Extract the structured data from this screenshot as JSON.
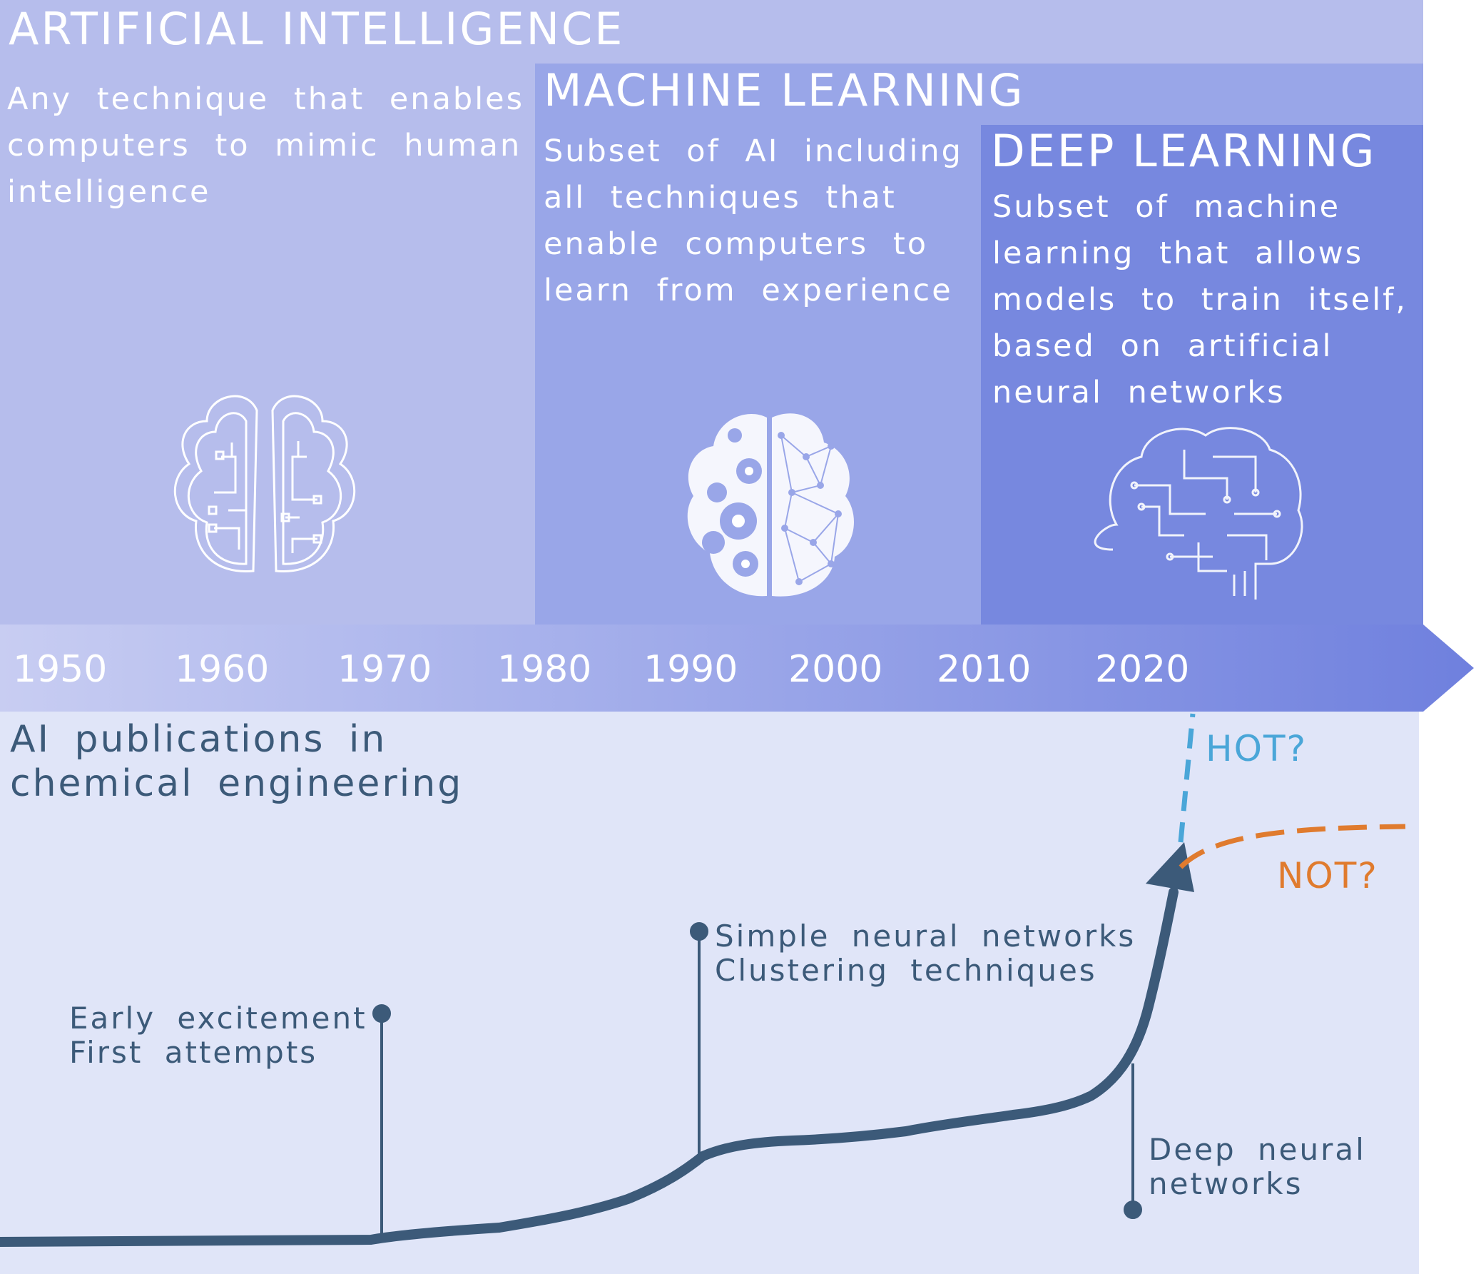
{
  "colors": {
    "ai_panel": "#b6bdec",
    "ml_panel": "#99a6e8",
    "dl_panel": "#7788df",
    "lower_bg": "#e0e5f8",
    "curve": "#3c5a79",
    "hot": "#4aa6d8",
    "not": "#e07b2e"
  },
  "artificial_intelligence": {
    "title": "ARTIFICIAL INTELLIGENCE",
    "description": "Any technique that enables computers to mimic human intelligence",
    "icon": "circuit-brain-icon"
  },
  "machine_learning": {
    "title": "MACHINE LEARNING",
    "description": "Subset of AI including all techniques that enable computers to learn from experience",
    "icon": "gear-network-brain-icon"
  },
  "deep_learning": {
    "title": "DEEP LEARNING",
    "description": "Subset of machine learning that allows models to train itself, based on artificial neural networks",
    "icon": "circuit-board-brain-icon"
  },
  "timeline": {
    "years": [
      "1950",
      "1960",
      "1970",
      "1980",
      "1990",
      "2000",
      "2010",
      "2020"
    ]
  },
  "graph": {
    "title": "AI publications in chemical engineering",
    "milestones": [
      {
        "line1": "Early excitement",
        "line2": "First attempts"
      },
      {
        "line1": "Simple neural networks",
        "line2": "Clustering techniques"
      },
      {
        "line1": "Deep neural",
        "line2": "networks"
      }
    ],
    "outlook_hot": "HOT?",
    "outlook_not": "NOT?"
  }
}
